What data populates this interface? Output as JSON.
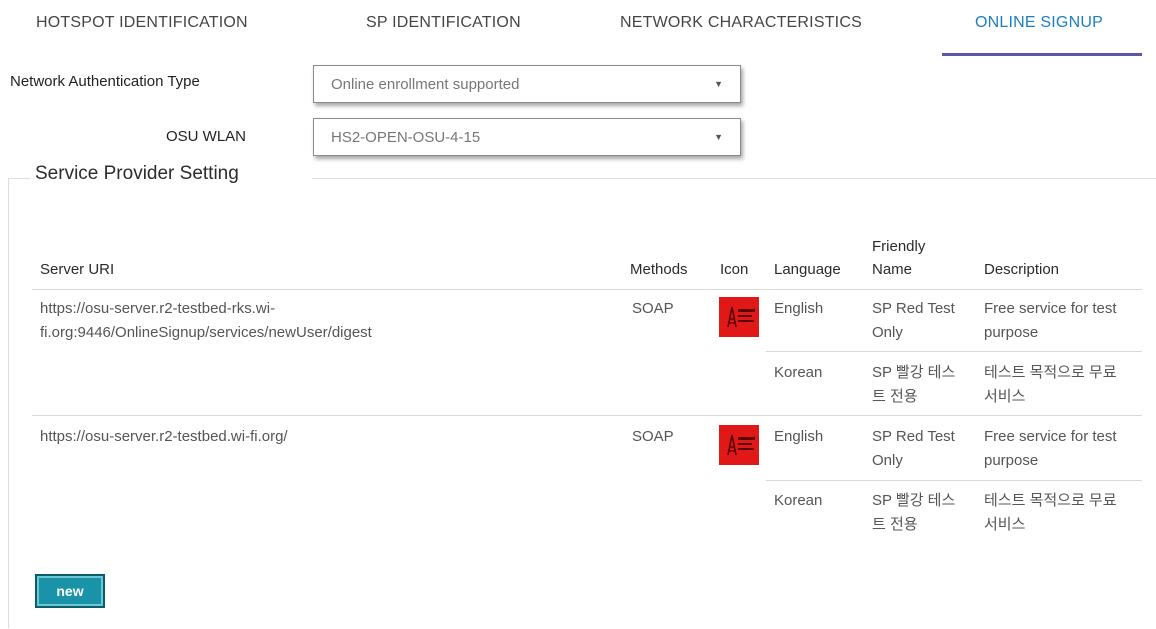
{
  "tabs": [
    {
      "label": "HOTSPOT IDENTIFICATION",
      "active": false
    },
    {
      "label": "SP IDENTIFICATION",
      "active": false
    },
    {
      "label": "NETWORK CHARACTERISTICS",
      "active": false
    },
    {
      "label": "ONLINE SIGNUP",
      "active": true
    }
  ],
  "form": {
    "auth_type_label": "Network Authentication Type",
    "auth_type_value": "Online enrollment supported",
    "osu_wlan_label": "OSU WLAN",
    "osu_wlan_value": "HS2-OPEN-OSU-4-15"
  },
  "section": {
    "legend": "Service Provider Setting"
  },
  "table": {
    "headers": {
      "server_uri": "Server URI",
      "methods": "Methods",
      "icon": "Icon",
      "language": "Language",
      "friendly_name": "Friendly Name",
      "description": "Description"
    },
    "rows": [
      {
        "server_uri": "https://osu-server.r2-testbed-rks.wi-fi.org:9446/OnlineSignup/services/newUser/digest",
        "methods": "SOAP",
        "icon": "red-sp-icon",
        "entries": [
          {
            "language": "English",
            "friendly_name": "SP Red Test Only",
            "description": "Free service for test purpose"
          },
          {
            "language": "Korean",
            "friendly_name": "SP 빨강 테스트 전용",
            "description": "테스트 목적으로 무료 서비스"
          }
        ]
      },
      {
        "server_uri": "https://osu-server.r2-testbed.wi-fi.org/",
        "methods": "SOAP",
        "icon": "red-sp-icon",
        "entries": [
          {
            "language": "English",
            "friendly_name": "SP Red Test Only",
            "description": "Free service for test purpose"
          },
          {
            "language": "Korean",
            "friendly_name": "SP 빨강 테스트 전용",
            "description": "테스트 목적으로 무료 서비스"
          }
        ]
      }
    ]
  },
  "actions": {
    "new_label": "new"
  },
  "colors": {
    "active_tab": "#1a7fc1",
    "tab_underline": "#5a56a8",
    "icon_red": "#e01818",
    "new_button": "#1a93a8"
  }
}
